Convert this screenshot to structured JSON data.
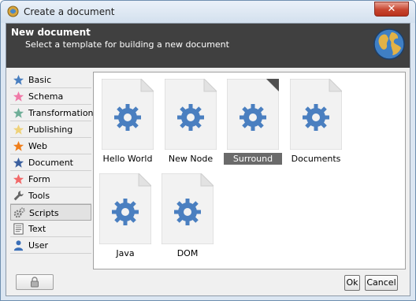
{
  "window": {
    "title": "Create a document"
  },
  "header": {
    "title": "New document",
    "subtitle": "Select a template for building a new document"
  },
  "sidebar": {
    "items": [
      {
        "label": "Basic",
        "icon": "star-icon",
        "color": "#4a7fc0"
      },
      {
        "label": "Schema",
        "icon": "star-icon",
        "color": "#f07aa8"
      },
      {
        "label": "Transformation",
        "icon": "star-icon",
        "color": "#6fae98"
      },
      {
        "label": "Publishing",
        "icon": "star-icon",
        "color": "#efd27a"
      },
      {
        "label": "Web",
        "icon": "star-icon",
        "color": "#f07f1c"
      },
      {
        "label": "Document",
        "icon": "star-icon",
        "color": "#3a5f9e"
      },
      {
        "label": "Form",
        "icon": "star-icon",
        "color": "#f26a6a"
      },
      {
        "label": "Tools",
        "icon": "wrench-icon",
        "color": "#666666"
      },
      {
        "label": "Scripts",
        "icon": "gears-icon",
        "color": "#777777",
        "active": true
      },
      {
        "label": "Text",
        "icon": "text-file-icon",
        "color": "#555555"
      },
      {
        "label": "User",
        "icon": "user-icon",
        "color": "#3a6fb8"
      }
    ]
  },
  "templates": [
    {
      "label": "Hello World",
      "icon": "gear-icon",
      "selected": false
    },
    {
      "label": "New Node",
      "icon": "gear-icon",
      "selected": false
    },
    {
      "label": "Surround",
      "icon": "gear-icon",
      "selected": true
    },
    {
      "label": "Documents",
      "icon": "gear-icon",
      "selected": false
    },
    {
      "label": "Java",
      "icon": "gear-icon",
      "selected": false
    },
    {
      "label": "DOM",
      "icon": "gear-icon",
      "selected": false
    }
  ],
  "buttons": {
    "ok": "Ok",
    "cancel": "Cancel",
    "lock_icon": "lock-icon"
  },
  "colors": {
    "header_bg": "#404040",
    "gear": "#4a7fc0",
    "selected_label_bg": "#6a6a6a"
  }
}
